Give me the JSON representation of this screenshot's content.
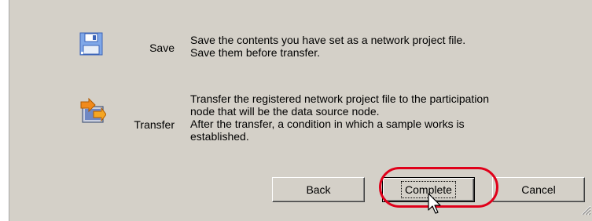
{
  "steps": [
    {
      "icon": "floppy-disk-icon",
      "label": "Save",
      "description": "Save the contents you have set as a network project file.\nSave them before transfer."
    },
    {
      "icon": "transfer-icon",
      "label": "Transfer",
      "description": "Transfer the registered network project file to the participation\nnode that will be the data source node.\nAfter the transfer, a condition in which a sample works is\nestablished."
    }
  ],
  "buttons": {
    "back": "Back",
    "complete": "Complete",
    "cancel": "Cancel"
  },
  "annotation": {
    "highlight_color": "#e0001a",
    "highlighted_button": "Complete"
  },
  "cursor": "arrow-pointer-icon"
}
